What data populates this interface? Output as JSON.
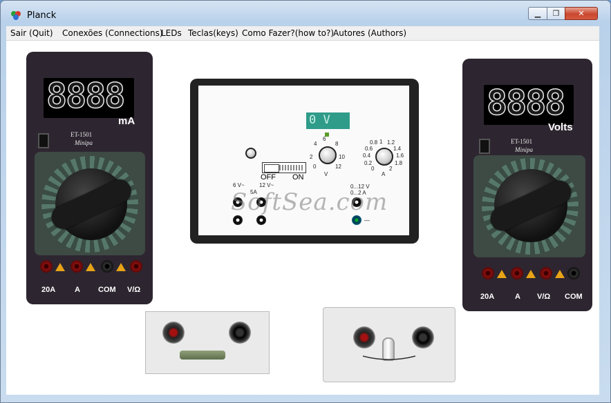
{
  "window": {
    "title": "Planck",
    "min_glyph": "▁",
    "max_glyph": "❐",
    "close_glyph": "✕"
  },
  "menu": {
    "items": [
      {
        "label": "Sair (Quit)"
      },
      {
        "label": "Conexões (Connections)"
      },
      {
        "label": "LEDs"
      },
      {
        "label": "Teclas(keys)"
      },
      {
        "label": "Como Fazer?(how to?)"
      },
      {
        "label": "Autores (Authors)"
      }
    ]
  },
  "ammeter": {
    "reading": "8888",
    "unit": "mA",
    "model": "ET-1501",
    "brand": "Minipa",
    "jacks": [
      "20A",
      "A",
      "COM",
      "V/Ω"
    ]
  },
  "voltmeter": {
    "reading": "8888",
    "unit": "Volts",
    "model": "ET-1501",
    "brand": "Minipa",
    "jacks": [
      "20A",
      "A",
      "V/Ω",
      "COM"
    ]
  },
  "power_supply": {
    "display": "0 V",
    "switch_off": "OFF",
    "switch_on": "ON",
    "voltage_scale": [
      "0",
      "2",
      "4",
      "6",
      "8",
      "10",
      "12"
    ],
    "voltage_label": "V",
    "current_scale": [
      "0",
      "0.2",
      "0.4",
      "0.6",
      "0.8",
      "1",
      "1.2",
      "1.4",
      "1.6",
      "1.8",
      "2"
    ],
    "current_label": "A",
    "ac_label": "6 V~",
    "ac_label2": "12 V~",
    "ac_current": "5A",
    "dc_label": "0...12 V",
    "dc_current": "0...2 A",
    "minus": "—"
  },
  "watermark": "SoftSea.com",
  "colors": {
    "accent": "#2f9c8a",
    "meter_body": "#2d2630",
    "warning": "#e8a316",
    "close_button": "#c9472f"
  }
}
